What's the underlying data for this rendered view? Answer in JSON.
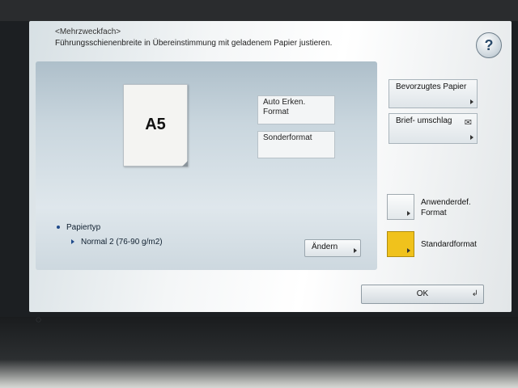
{
  "header": {
    "context": "<Mehrzweckfach>",
    "instruction": "Führungsschienenbreite in Übereinstimmung mit geladenem Papier justieren.",
    "help_icon": "help-icon",
    "help_label": "?"
  },
  "paper": {
    "size": "A5"
  },
  "format_buttons": {
    "auto": "Auto Erken. Format",
    "custom": "Sonderformat"
  },
  "paper_type": {
    "label": "Papiertyp",
    "value": "Normal 2 (76-90 g/m2)",
    "change_button": "Ändern"
  },
  "side_buttons": {
    "preferred": "Bevorzugtes Papier",
    "envelope": "Brief- umschlag",
    "envelope_icon": "envelope-icon"
  },
  "format_options": {
    "user_defined": "Anwenderdef. Format",
    "standard": "Standardformat",
    "standard_color": "#f0c21c"
  },
  "footer": {
    "ok": "OK"
  }
}
